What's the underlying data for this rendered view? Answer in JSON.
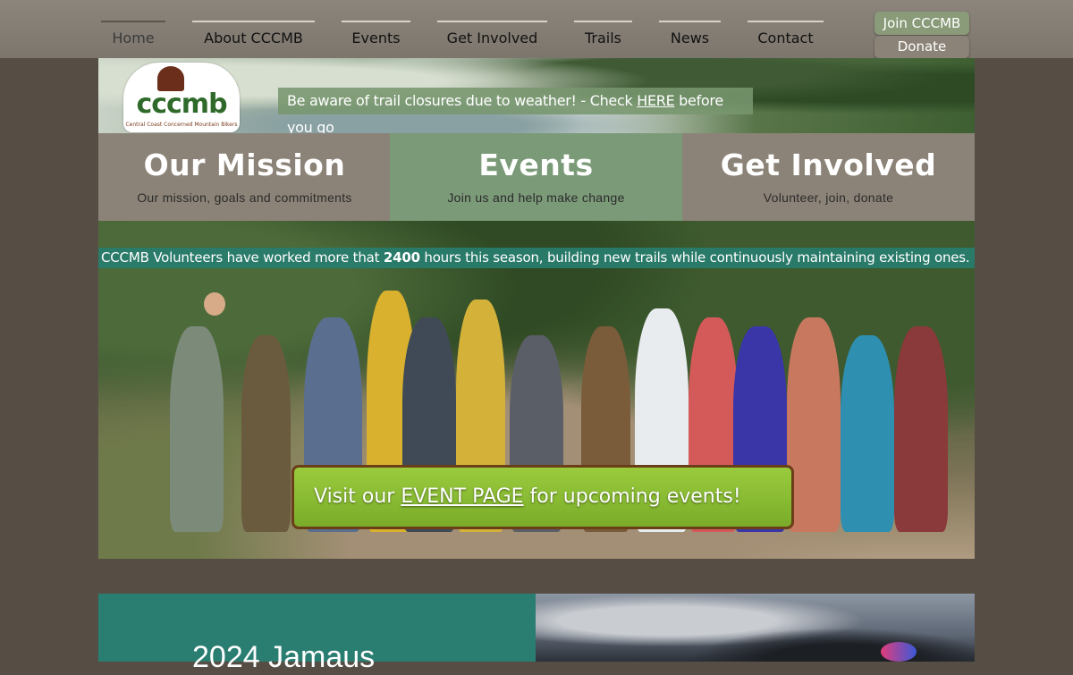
{
  "nav": {
    "items": [
      {
        "label": "Home",
        "active": true
      },
      {
        "label": "About CCCMB",
        "active": false
      },
      {
        "label": "Events",
        "active": false
      },
      {
        "label": "Get Involved",
        "active": false
      },
      {
        "label": "Trails",
        "active": false
      },
      {
        "label": "News",
        "active": false
      },
      {
        "label": "Contact",
        "active": false
      }
    ],
    "join_label": "Join CCCMB",
    "donate_label": "Donate"
  },
  "logo": {
    "text": "cccmb",
    "subtitle": "Central Coast Concerned Mountain Bikers"
  },
  "alert": {
    "prefix": "Be aware of trail closures due to weather!  -  Check ",
    "link": "HERE",
    "suffix": " before you go"
  },
  "tiles": [
    {
      "title": "Our Mission",
      "subtitle": "Our mission, goals and commitments"
    },
    {
      "title": "Events",
      "subtitle": "Join us and help make change"
    },
    {
      "title": "Get Involved",
      "subtitle": "Volunteer, join, donate"
    }
  ],
  "stats": {
    "prefix": "CCCMB Volunteers have worked more that ",
    "hours": "2400",
    "suffix": " hours this season, building new trails while continuously maintaining existing  ones."
  },
  "event_cta": {
    "prefix": "Visit our ",
    "link": "EVENT PAGE",
    "suffix": " for upcoming events!"
  },
  "lower": {
    "title": "2024 Jamaus"
  },
  "colors": {
    "background": "#564e45",
    "tile_brown": "#8c8378",
    "tile_green": "#7b9a78",
    "teal": "#2a7d71",
    "cta_green": "#8cbf35"
  }
}
